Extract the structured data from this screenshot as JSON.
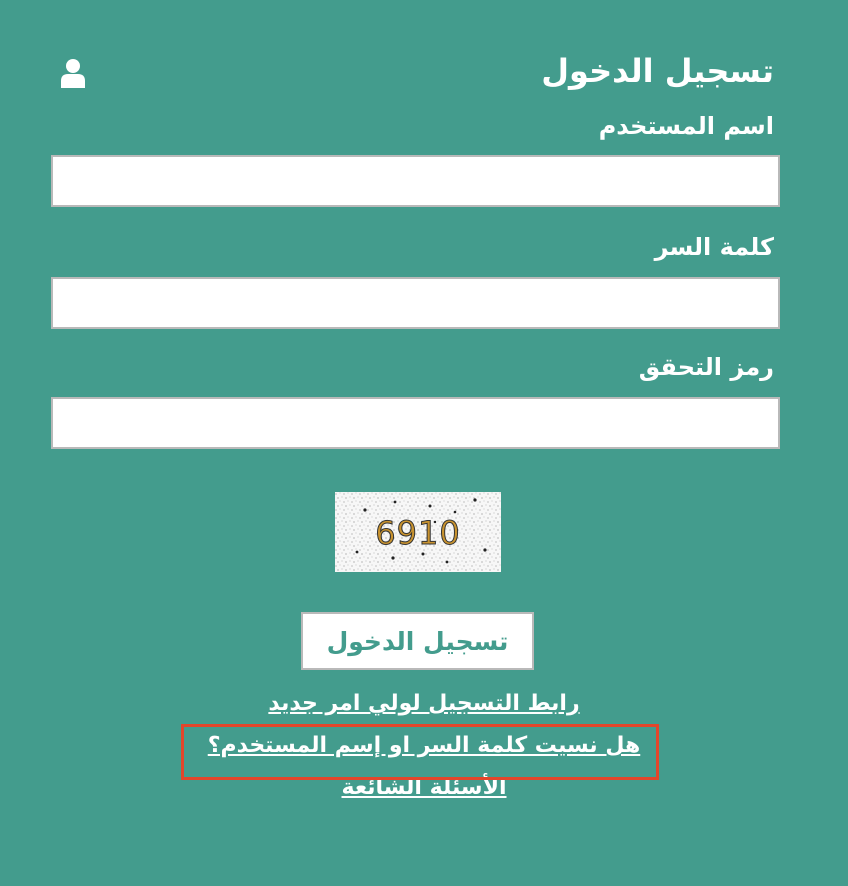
{
  "login": {
    "title": "تسجيل الدخول",
    "username_label": "اسم المستخدم",
    "username_value": "",
    "password_label": "كلمة السر",
    "password_value": "",
    "captcha_label": "رمز التحقق",
    "captcha_value": "",
    "captcha_text": "6910",
    "submit_label": "تسجيل الدخول"
  },
  "links": {
    "register_parent": "رابط التسجيل لولي امر جديد",
    "forgot_credentials": "هل نسيت كلمة السر او إسم المستخدم؟",
    "faq": "الأسئلة الشائعة"
  },
  "icons": {
    "user": "user-icon"
  },
  "colors": {
    "background": "#439c8d",
    "text": "#ffffff",
    "button_text": "#439c8d",
    "highlight": "#e2462a"
  }
}
